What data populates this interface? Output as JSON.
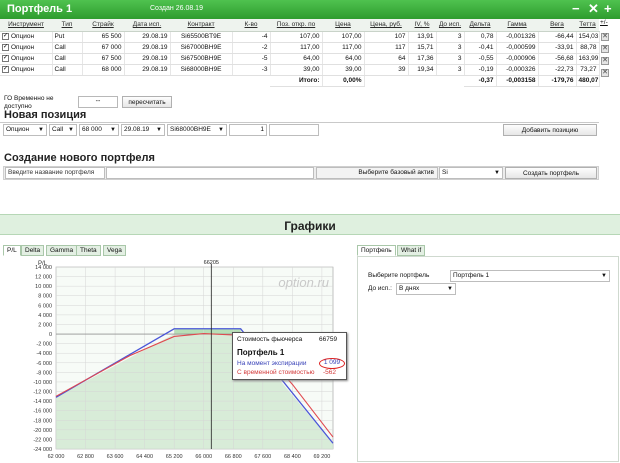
{
  "header": {
    "title": "Портфель 1",
    "created": "Создан 26.08.19",
    "icons": [
      "minimize-icon",
      "close-icon",
      "add-icon"
    ]
  },
  "columns": [
    "Инструмент",
    "Тип",
    "Страйк",
    "Дата исп.",
    "Контракт",
    "К-во",
    "Поз. откр. по",
    "Цена",
    "Цена, руб.",
    "IV, %",
    "До исп.",
    "Дельта",
    "Гамма",
    "Вега",
    "Тетта",
    "+/-"
  ],
  "rows": [
    {
      "instrument": "Опцион",
      "type": "Put",
      "strike": "65 500",
      "date": "29.08.19",
      "contract": "Si65500BT9E",
      "qty": "-4",
      "open": "107,00",
      "price": "107,00",
      "price_rub": "107",
      "iv": "13,91",
      "days": "3",
      "delta": "0,78",
      "gamma": "-0,001326",
      "vega": "-66,44",
      "theta": "154,03"
    },
    {
      "instrument": "Опцион",
      "type": "Call",
      "strike": "67 000",
      "date": "29.08.19",
      "contract": "Si67000BH9E",
      "qty": "-2",
      "open": "117,00",
      "price": "117,00",
      "price_rub": "117",
      "iv": "15,71",
      "days": "3",
      "delta": "-0,41",
      "gamma": "-0,000599",
      "vega": "-33,91",
      "theta": "88,78"
    },
    {
      "instrument": "Опцион",
      "type": "Call",
      "strike": "67 500",
      "date": "29.08.19",
      "contract": "Si67500BH9E",
      "qty": "-5",
      "open": "64,00",
      "price": "64,00",
      "price_rub": "64",
      "iv": "17,36",
      "days": "3",
      "delta": "-0,55",
      "gamma": "-0,000906",
      "vega": "-56,68",
      "theta": "163,99"
    },
    {
      "instrument": "Опцион",
      "type": "Call",
      "strike": "68 000",
      "date": "29.08.19",
      "contract": "Si68000BH9E",
      "qty": "-3",
      "open": "39,00",
      "price": "39,00",
      "price_rub": "39",
      "iv": "19,34",
      "days": "3",
      "delta": "-0,19",
      "gamma": "-0,000326",
      "vega": "-22,73",
      "theta": "73,27"
    }
  ],
  "totals": {
    "label": "Итого:",
    "percent": "0,00%",
    "delta": "-0,37",
    "gamma": "-0,003158",
    "vega": "-179,76",
    "theta": "480,07"
  },
  "go_label": "ГО Временно не доступно",
  "go_value": "--",
  "recalc": "пересчитать",
  "new_position": {
    "title": "Новая позиция",
    "instrument": "Опцион",
    "type": "Call",
    "strike": "68 000",
    "date": "29.08.19",
    "contract": "Si68000BH9E",
    "qty": "1",
    "add": "Добавить позицию"
  },
  "new_portfolio": {
    "title": "Создание нового портфеля",
    "name_placeholder": "Введите название портфеля",
    "base_label": "Выберите базовый актив",
    "base_value": "Si",
    "create": "Создать портфель"
  },
  "graphs": {
    "title": "Графики",
    "tabs": [
      "P/L",
      "Delta",
      "Gamma",
      "Theta",
      "Vega"
    ],
    "right_tabs": [
      "Портфель",
      "What if"
    ],
    "select_label": "Выберите портфель",
    "select_value": "Портфель 1",
    "exp_label": "До исп.:",
    "exp_value": "В днях"
  },
  "chart_data": {
    "type": "line",
    "watermark": "option.ru",
    "ylabel": "P/L",
    "marker_x_label": "66205",
    "marker_x": 66205,
    "xlim": [
      62000,
      69500
    ],
    "ylim": [
      -24000,
      14000
    ],
    "xticks": [
      62000,
      62800,
      63600,
      64400,
      65200,
      66000,
      66800,
      67600,
      68400,
      69200
    ],
    "xtick_labels": [
      "62 000",
      "62 800",
      "63 600",
      "64 400",
      "65 200",
      "66 000",
      "66 800",
      "67 600",
      "68 400",
      "69 200"
    ],
    "yticks": [
      14000,
      12000,
      10000,
      8000,
      6000,
      4000,
      2000,
      0,
      -2000,
      -4000,
      -6000,
      -8000,
      -10000,
      -12000,
      -14000,
      -16000,
      -18000,
      -20000,
      -22000,
      -24000
    ],
    "ytick_labels": [
      "14 000",
      "12 000",
      "10 000",
      "8 000",
      "6 000",
      "4 000",
      "2 000",
      "0",
      "-2 000",
      "-4 000",
      "-6 000",
      "-8 000",
      "-10 000",
      "-12 000",
      "-14 000",
      "-16 000",
      "-18 000",
      "-20 000",
      "-22 000",
      "-24 000"
    ],
    "series": [
      {
        "key": "expiration",
        "color": "#4a55d8",
        "points": [
          [
            62000,
            -13200
          ],
          [
            65200,
            1100
          ],
          [
            67000,
            1100
          ],
          [
            69500,
            -22800
          ]
        ]
      },
      {
        "key": "time_value",
        "color": "#e0494f",
        "points": [
          [
            62000,
            -13000
          ],
          [
            64000,
            -4500
          ],
          [
            65200,
            -500
          ],
          [
            66000,
            100
          ],
          [
            66800,
            -200
          ],
          [
            67600,
            -3500
          ],
          [
            68400,
            -10500
          ],
          [
            69500,
            -21500
          ]
        ]
      }
    ],
    "tooltip": {
      "futures_label": "Стоимость фьючерса",
      "futures_value": "66759",
      "title": "Портфель 1",
      "exp_label": "На момент экспирации",
      "exp_value": "1 099",
      "tv_label": "С временной стоимостью",
      "tv_value": "-562"
    }
  }
}
